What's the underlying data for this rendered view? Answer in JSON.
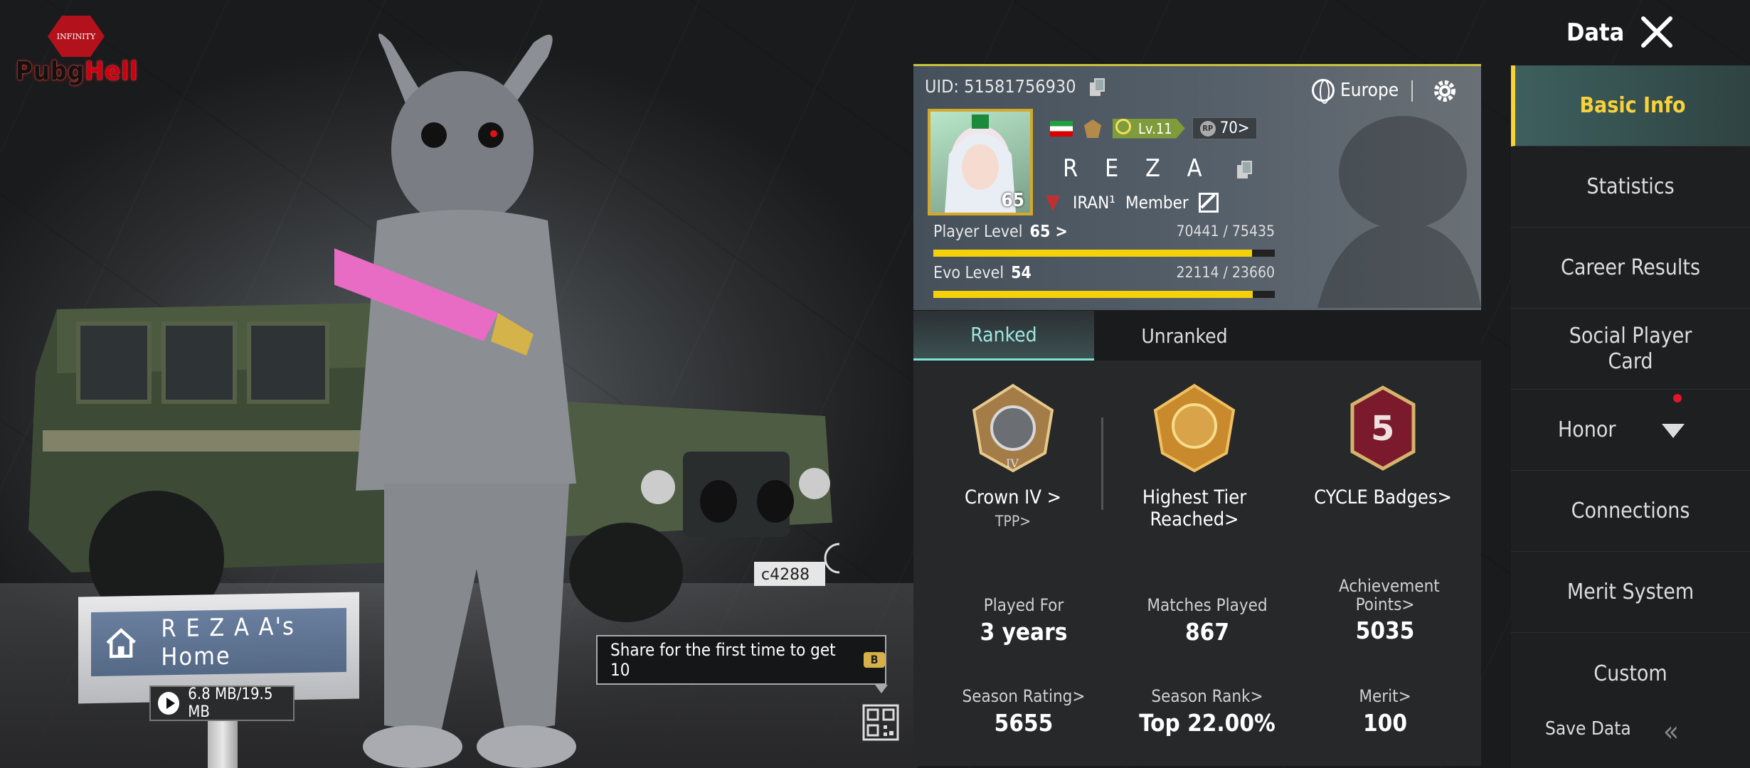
{
  "logo": {
    "top": "INFINITY",
    "word": "PubgHell"
  },
  "header": {
    "title": "Data"
  },
  "home": {
    "title": "R E Z A A's Home",
    "size": "6.8 MB/19.5 MB"
  },
  "share": {
    "text": "Share for the first time to get 10"
  },
  "plate": "c4288",
  "profile": {
    "uid": "UID: 51581756930",
    "region": "Europe",
    "name": "R E Z A",
    "avatar_level": "65",
    "lv_badge": "Lv.11",
    "rp": "70>",
    "clan": "IRAN¹",
    "role": "Member",
    "player_level_label": "Player Level",
    "player_level": "65 >",
    "player_xp": "70441 / 75435",
    "player_progress": 0.934,
    "evo_level_label": "Evo Level",
    "evo_level": "54",
    "evo_xp": "22114 / 23660",
    "evo_progress": 0.935
  },
  "tabs": [
    "Ranked",
    "Unranked"
  ],
  "tiers": {
    "current": "Crown IV >",
    "current_mode": "TPP>",
    "highest": "Highest Tier Reached>",
    "cycle": "CYCLE Badges>",
    "cycle_num": "5",
    "crown_roman": "IV"
  },
  "stats": [
    {
      "k": "Played For",
      "v": "3 years"
    },
    {
      "k": "Matches Played",
      "v": "867"
    },
    {
      "k": "Achievement Points>",
      "v": "5035"
    },
    {
      "k": "Season Rating>",
      "v": "5655"
    },
    {
      "k": "Season Rank>",
      "v": "Top 22.00%"
    },
    {
      "k": "Merit>",
      "v": "100"
    }
  ],
  "sidebar": {
    "items": [
      "Basic Info",
      "Statistics",
      "Career Results",
      "Social Player Card",
      "Honor",
      "Connections",
      "Merit System",
      "Custom"
    ],
    "save": "Save Data"
  },
  "colors": {
    "accent": "#f7d23a",
    "tab_active": "#9ee7e0",
    "bar": "#f5d10a"
  }
}
